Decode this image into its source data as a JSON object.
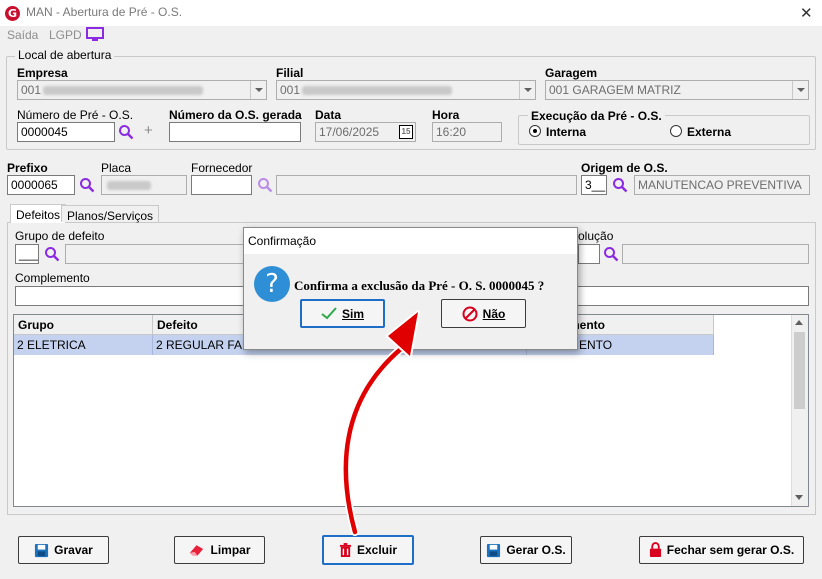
{
  "window": {
    "logo": "G",
    "title": "MAN - Abertura de Pré - O.S.",
    "close": "✕"
  },
  "menu": {
    "items": [
      "Saída",
      "LGPD"
    ],
    "screen_icon": "monitor-icon"
  },
  "local": {
    "title": "Local de abertura",
    "empresa_label": "Empresa",
    "empresa_value": "001",
    "filial_label": "Filial",
    "filial_value": "001",
    "garagem_label": "Garagem",
    "garagem_value": "001 GARAGEM MATRIZ",
    "numero_pre_label": "Número de Pré - O.S.",
    "numero_pre_value": "0000045",
    "add_symbol": "+",
    "numero_gerada_label": "Número da O.S. gerada",
    "numero_gerada_value": "",
    "data_label": "Data",
    "data_value": "17/06/2025",
    "calendar_glyph": "15",
    "hora_label": "Hora",
    "hora_value": "16:20",
    "execucao": {
      "title": "Execução da Pré - O.S.",
      "interna": "Interna",
      "externa": "Externa",
      "selected": "Interna"
    }
  },
  "vehicle": {
    "prefixo_label": "Prefixo",
    "prefixo_value": "0000065",
    "placa_label": "Placa",
    "placa_value": "",
    "fornecedor_label": "Fornecedor",
    "fornecedor_value": "",
    "origem_label": "Origem de O.S.",
    "origem_code": "3__",
    "origem_value": "MANUTENCAO PREVENTIVA"
  },
  "tabs": [
    "Defeitos",
    "Planos/Serviços"
  ],
  "defeitos": {
    "grupo_label": "Grupo de defeito",
    "grupo_value": "___",
    "solucao_label": "olução",
    "solucao_value": "",
    "complemento_label": "Complemento",
    "complemento_value": "",
    "columns": [
      "Grupo",
      "Defeito",
      "mento"
    ],
    "rows": [
      {
        "grupo": "2 ELETRICA",
        "defeito": "2 REGULAR FAR",
        "col3": "MENTO"
      }
    ]
  },
  "dialog": {
    "title": "Confirmação",
    "icon_glyph": "?",
    "message": "Confirma a exclusão da Pré - O. S. 0000045 ?",
    "yes_label": "Sim",
    "no_label": "Não"
  },
  "buttons": {
    "gravar": "Gravar",
    "limpar": "Limpar",
    "excluir": "Excluir",
    "gerar": "Gerar O.S.",
    "fechar": "Fechar sem gerar O.S."
  },
  "colors": {
    "accent_purple": "#8a2be2",
    "selection": "#c4d2f0",
    "arrow": "#e00000",
    "logo": "#c8102e"
  }
}
